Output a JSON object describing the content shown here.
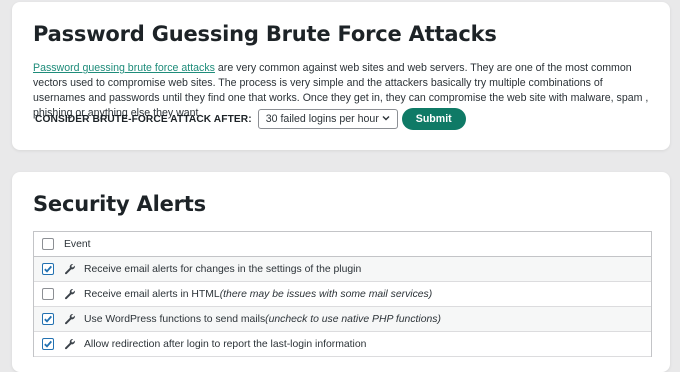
{
  "brute_force": {
    "title": "Password Guessing Brute Force Attacks",
    "link_text": "Password guessing brute force attacks",
    "description": " are very common against web sites and web servers. They are one of the most common vectors used to compromise web sites. The process is very simple and the attackers basically try multiple combinations of usernames and passwords until they find one that works. Once they get in, they can compromise the web site with malware, spam , phishing or anything else they want.",
    "form_label": "CONSIDER BRUTE-FORCE ATTACK AFTER:",
    "select_value": "30 failed logins per hour",
    "submit_label": "Submit"
  },
  "security_alerts": {
    "title": "Security Alerts",
    "header_label": "Event",
    "header_checked": false,
    "rows": [
      {
        "label": "Receive email alerts for changes in the settings of the plugin",
        "note": "",
        "checked": true,
        "icon": "wrench-icon"
      },
      {
        "label": "Receive email alerts in HTML ",
        "note": "(there may be issues with some mail services)",
        "checked": false,
        "icon": "wrench-icon"
      },
      {
        "label": "Use WordPress functions to send mails ",
        "note": "(uncheck to use native PHP functions)",
        "checked": true,
        "icon": "wrench-icon"
      },
      {
        "label": "Allow redirection after login to report the last-login information",
        "note": "",
        "checked": true,
        "icon": "wrench-icon"
      }
    ]
  },
  "colors": {
    "accent": "#0f7a66",
    "link": "#1e8c7a",
    "checkbox": "#2271b1"
  }
}
